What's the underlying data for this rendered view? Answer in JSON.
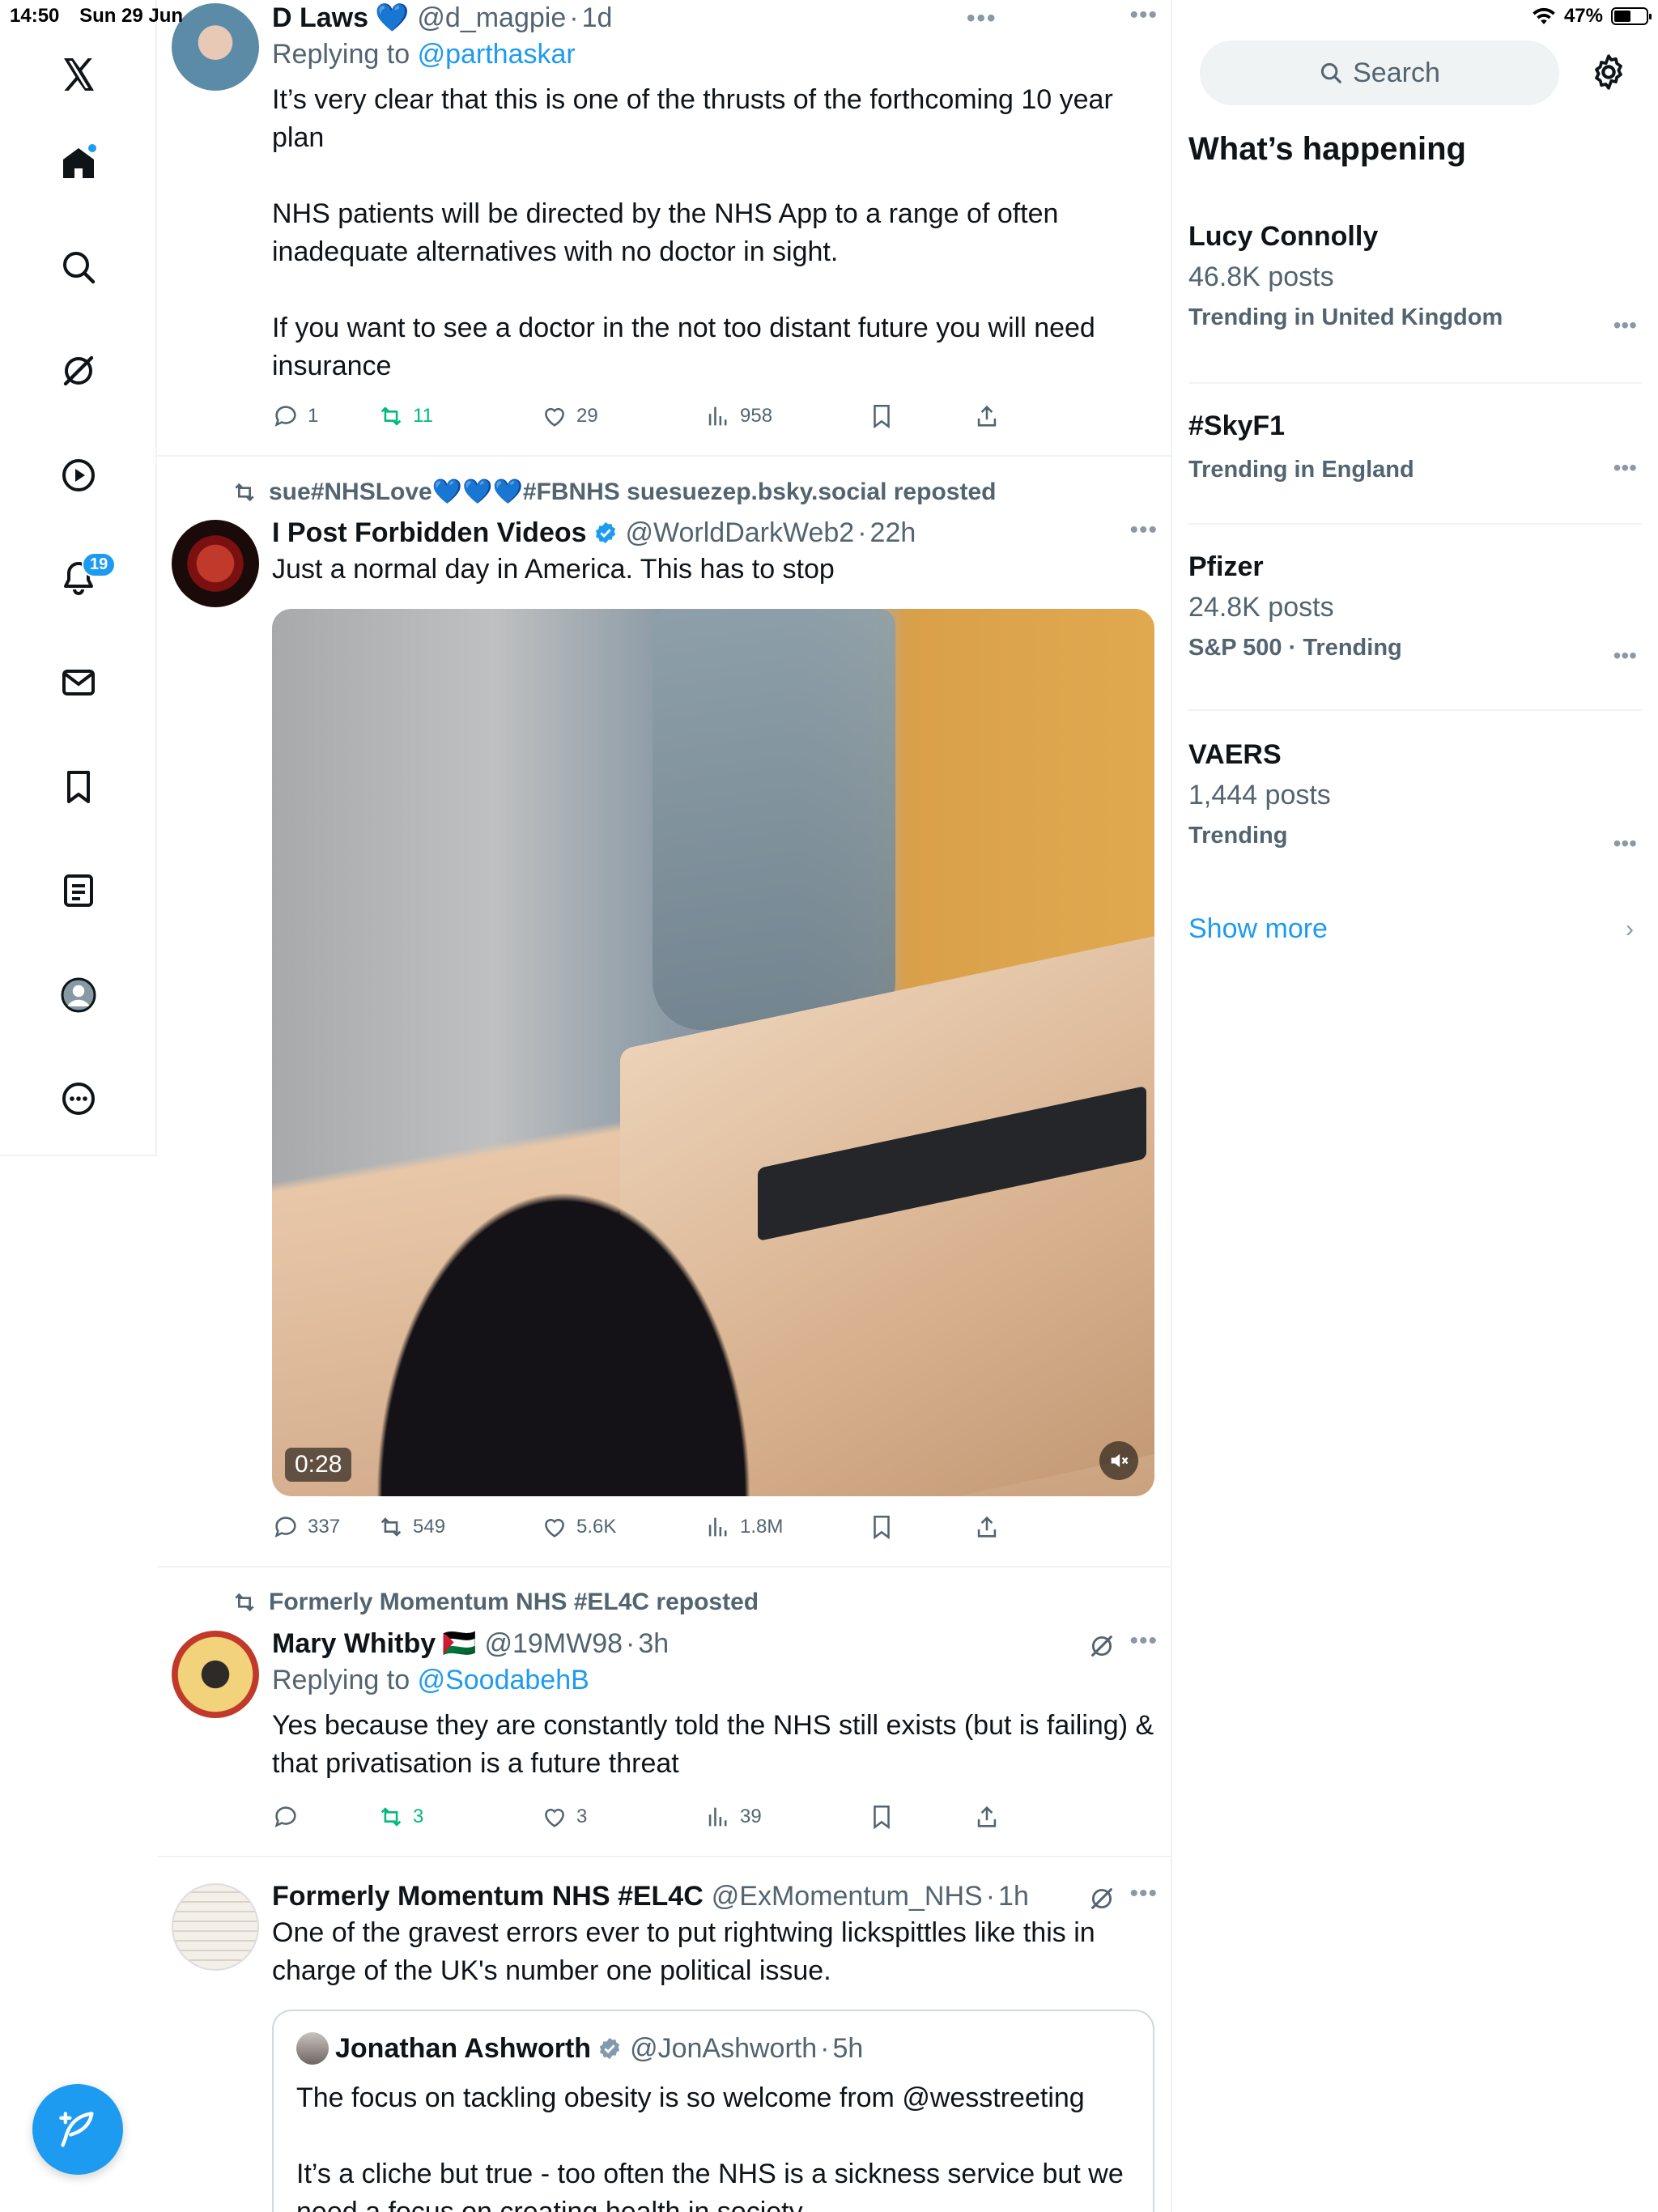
{
  "status_bar": {
    "time": "14:50",
    "date": "Sun 29 Jun",
    "battery": "47%"
  },
  "nav": {
    "notification_count": "19",
    "items": [
      "x-logo",
      "home",
      "explore",
      "grok",
      "video",
      "notifications",
      "messages",
      "bookmarks",
      "lists",
      "profile",
      "more"
    ]
  },
  "tweets": [
    {
      "name": "D Laws",
      "emoji": "💙",
      "handle": "@d_magpie",
      "time": "1d",
      "replying_label": "Replying to",
      "replying_to": "@parthaskar",
      "text": "It’s very clear that this is one of the thrusts of the forthcoming 10 year plan\n\nNHS patients will be directed by the NHS App to a range of often inadequate alternatives with no doctor in sight.\n\nIf you want to see a doctor in the not too distant future you will need insurance",
      "replies": "1",
      "reposts": "11",
      "likes": "29",
      "views": "958"
    },
    {
      "repost_context": "sue#NHSLove💙💙💙#FBNHS suesuezep.bsky.social reposted",
      "name": "I Post Forbidden Videos",
      "handle": "@WorldDarkWeb2",
      "time": "22h",
      "text": "Just a normal day in America. This has to stop",
      "video_duration": "0:28",
      "replies": "337",
      "reposts": "549",
      "likes": "5.6K",
      "views": "1.8M"
    },
    {
      "repost_context": "Formerly Momentum NHS #EL4C reposted",
      "name": "Mary Whitby",
      "emoji": "🇵🇸",
      "handle": "@19MW98",
      "time": "3h",
      "replying_label": "Replying to",
      "replying_to": "@SoodabehB",
      "text": "Yes because they are constantly told the NHS still exists (but is failing) & that privatisation is a future threat",
      "replies": "",
      "reposts": "3",
      "likes": "3",
      "views": "39"
    },
    {
      "name": "Formerly Momentum NHS #EL4C",
      "handle": "@ExMomentum_NHS",
      "time": "1h",
      "text": "One of the gravest errors ever to put rightwing lickspittles like this in charge of the UK's number one political issue.",
      "quote": {
        "name": "Jonathan Ashworth",
        "handle": "@JonAshworth",
        "time": "5h",
        "text": "The focus on tackling obesity is so welcome from @wesstreeting\n\nIt’s a cliche but true - too often the NHS is a sickness service but we need a focus on creating health in society"
      }
    }
  ],
  "sidebar": {
    "search_placeholder": "Search",
    "title": "What’s happening",
    "trends": [
      {
        "name": "Lucy Connolly",
        "posts": "46.8K posts",
        "context": "Trending in United Kingdom"
      },
      {
        "name": "#SkyF1",
        "posts": "",
        "context": "Trending in England"
      },
      {
        "name": "Pfizer",
        "posts": "24.8K posts",
        "context": "S&P 500 · Trending"
      },
      {
        "name": "VAERS",
        "posts": "1,444 posts",
        "context": "Trending"
      }
    ],
    "show_more": "Show more"
  },
  "colors": {
    "accent": "#1d9bf0",
    "repost_green": "#00ba7c",
    "muted": "#536471"
  }
}
